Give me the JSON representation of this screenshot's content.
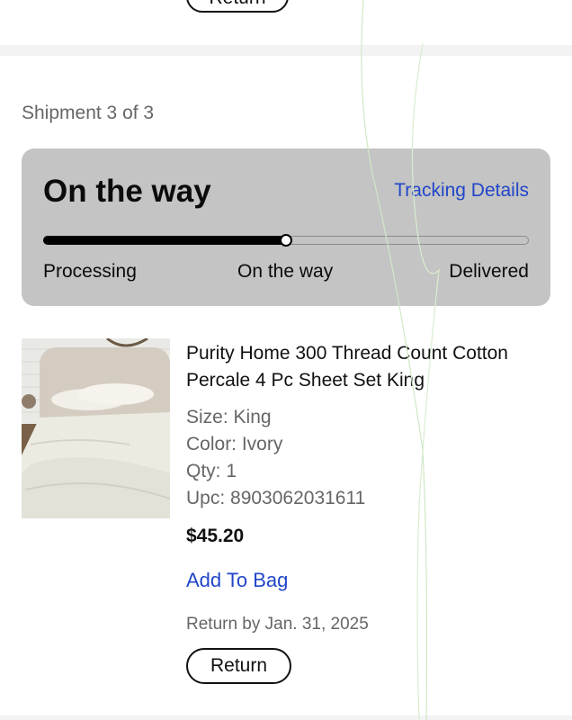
{
  "top": {
    "return_label": "Return"
  },
  "shipment": {
    "label": "Shipment 3 of 3",
    "status_title": "On the way",
    "tracking_link": "Tracking Details",
    "progress_fraction": 0.5,
    "steps": [
      "Processing",
      "On the way",
      "Delivered"
    ]
  },
  "product": {
    "title": "Purity Home 300 Thread Count Cotton Percale 4 Pc Sheet Set King",
    "size": "Size: King",
    "color": "Color: Ivory",
    "qty": "Qty: 1",
    "upc": "Upc: 8903062031611",
    "price": "$45.20",
    "add_to_bag": "Add To Bag",
    "return_by": "Return by Jan. 31, 2025",
    "return_label": "Return"
  },
  "colors": {
    "link": "#2146c8",
    "card_bg": "#c4c4c4",
    "divider": "#f3f3f3"
  }
}
